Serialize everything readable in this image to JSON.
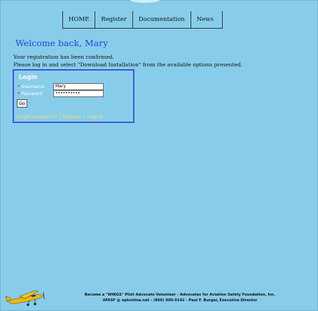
{
  "nav": {
    "items": [
      {
        "label": "HOME"
      },
      {
        "label": "Register"
      },
      {
        "label": "Documentation"
      },
      {
        "label": "News"
      }
    ]
  },
  "main": {
    "welcome": "Welcome back, Mary",
    "message_line1": "Your registration has been confirmed.",
    "message_line2": "Please log in and select \"Download Installation\" from the available options presented."
  },
  "login": {
    "title": "Login",
    "required_marker": "*",
    "username_label": "Username",
    "username_value": "Mary",
    "password_label": "Password",
    "password_value": "••••••••••",
    "go_label": "Go",
    "links": {
      "forgot": "Forgot password?",
      "register": "Register",
      "logout": "Logout",
      "separator": "|"
    }
  },
  "footer": {
    "line1": "Become a \"WINGS\" Pilot Advocate Volunteer - Advocates for Aviation Safety Foundation, Inc.",
    "line2": "AFASF @ optonline.net - (866) 900-9142 - Paul F. Burger, Executive Director"
  },
  "colors": {
    "background": "#87cdea",
    "welcome_text": "#1e48d8",
    "login_border": "#3a59d8",
    "link_text": "#f5e070"
  },
  "icons": {
    "footer_logo": "plane-icon"
  }
}
